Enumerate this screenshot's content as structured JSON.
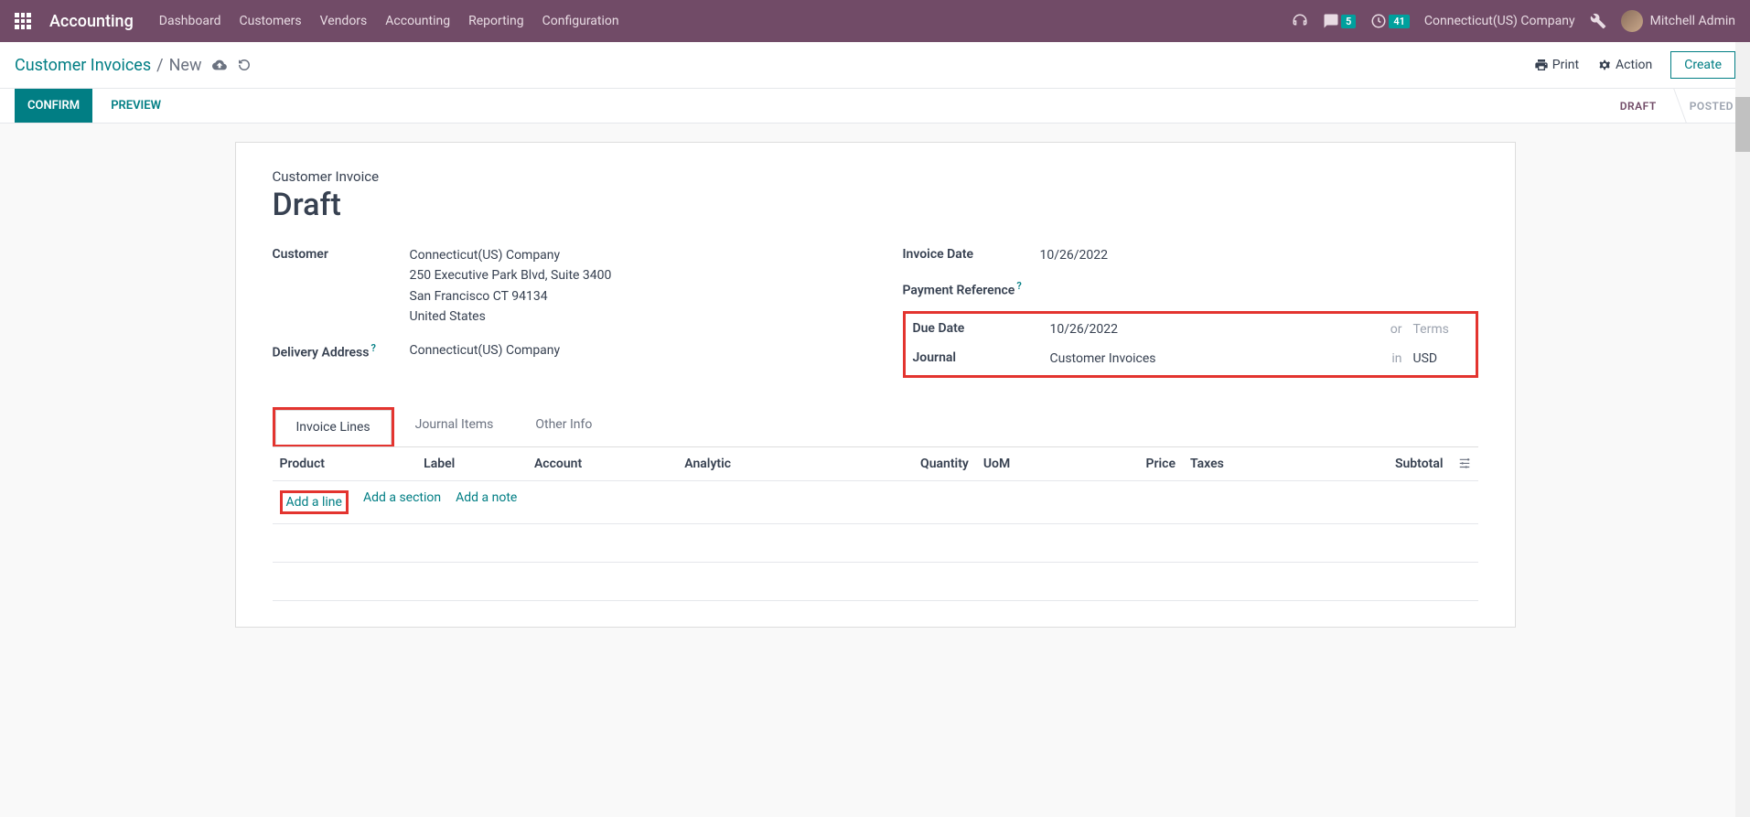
{
  "navbar": {
    "brand": "Accounting",
    "menu": [
      "Dashboard",
      "Customers",
      "Vendors",
      "Accounting",
      "Reporting",
      "Configuration"
    ],
    "messages_badge": "5",
    "activities_badge": "41",
    "company": "Connecticut(US) Company",
    "user": "Mitchell Admin"
  },
  "breadcrumb": {
    "parent": "Customer Invoices",
    "current": "New",
    "print": "Print",
    "action": "Action",
    "create": "Create"
  },
  "statusbar": {
    "confirm": "CONFIRM",
    "preview": "PREVIEW",
    "draft": "DRAFT",
    "posted": "POSTED"
  },
  "form": {
    "subtitle": "Customer Invoice",
    "title": "Draft",
    "labels": {
      "customer": "Customer",
      "delivery_address": "Delivery Address",
      "invoice_date": "Invoice Date",
      "payment_reference": "Payment Reference",
      "due_date": "Due Date",
      "journal": "Journal"
    },
    "customer": {
      "name": "Connecticut(US) Company",
      "street": "250 Executive Park Blvd, Suite 3400",
      "city": "San Francisco CT 94134",
      "country": "United States"
    },
    "delivery_address": "Connecticut(US) Company",
    "invoice_date": "10/26/2022",
    "payment_reference": "",
    "due_date": "10/26/2022",
    "due_date_or": "or",
    "terms_placeholder": "Terms",
    "journal": "Customer Invoices",
    "journal_in": "in",
    "currency": "USD"
  },
  "tabs": {
    "invoice_lines": "Invoice Lines",
    "journal_items": "Journal Items",
    "other_info": "Other Info"
  },
  "table": {
    "headers": {
      "product": "Product",
      "label": "Label",
      "account": "Account",
      "analytic": "Analytic",
      "quantity": "Quantity",
      "uom": "UoM",
      "price": "Price",
      "taxes": "Taxes",
      "subtotal": "Subtotal"
    },
    "add_line": "Add a line",
    "add_section": "Add a section",
    "add_note": "Add a note"
  }
}
